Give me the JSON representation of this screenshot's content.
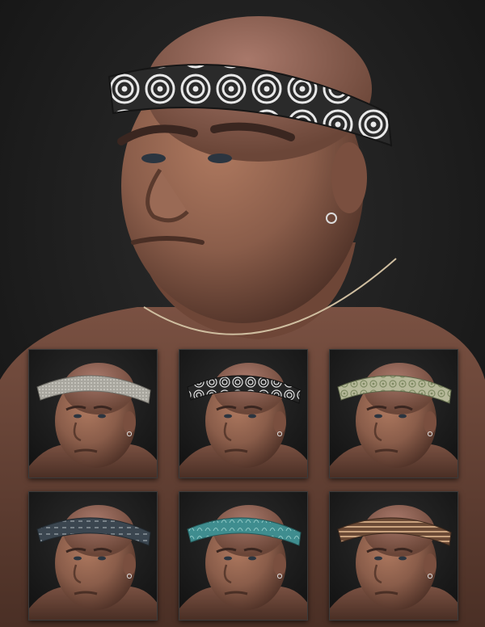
{
  "scene": {
    "background_color": "#1f1f1f",
    "skin_color": "#8a5d4a",
    "skin_shadow": "#5a3a2d"
  },
  "hero": {
    "headband_pattern": "concentric-circles",
    "headband_colors": [
      "#2a2a2a",
      "#e8e8e8"
    ]
  },
  "variants": [
    {
      "pattern": "plain-knit",
      "colors": [
        "#a9a79f",
        "#c4c2ba"
      ]
    },
    {
      "pattern": "concentric-circles",
      "colors": [
        "#262626",
        "#e6e6e6"
      ]
    },
    {
      "pattern": "paisley",
      "colors": [
        "#b7b99a",
        "#7f8a63"
      ]
    },
    {
      "pattern": "stitched-stripe",
      "colors": [
        "#3b4650",
        "#9aa2a8"
      ]
    },
    {
      "pattern": "teal-paisley",
      "colors": [
        "#3f8d8f",
        "#8cc7c4"
      ]
    },
    {
      "pattern": "woven-stripe",
      "colors": [
        "#6b4a36",
        "#c9a27e"
      ]
    }
  ]
}
